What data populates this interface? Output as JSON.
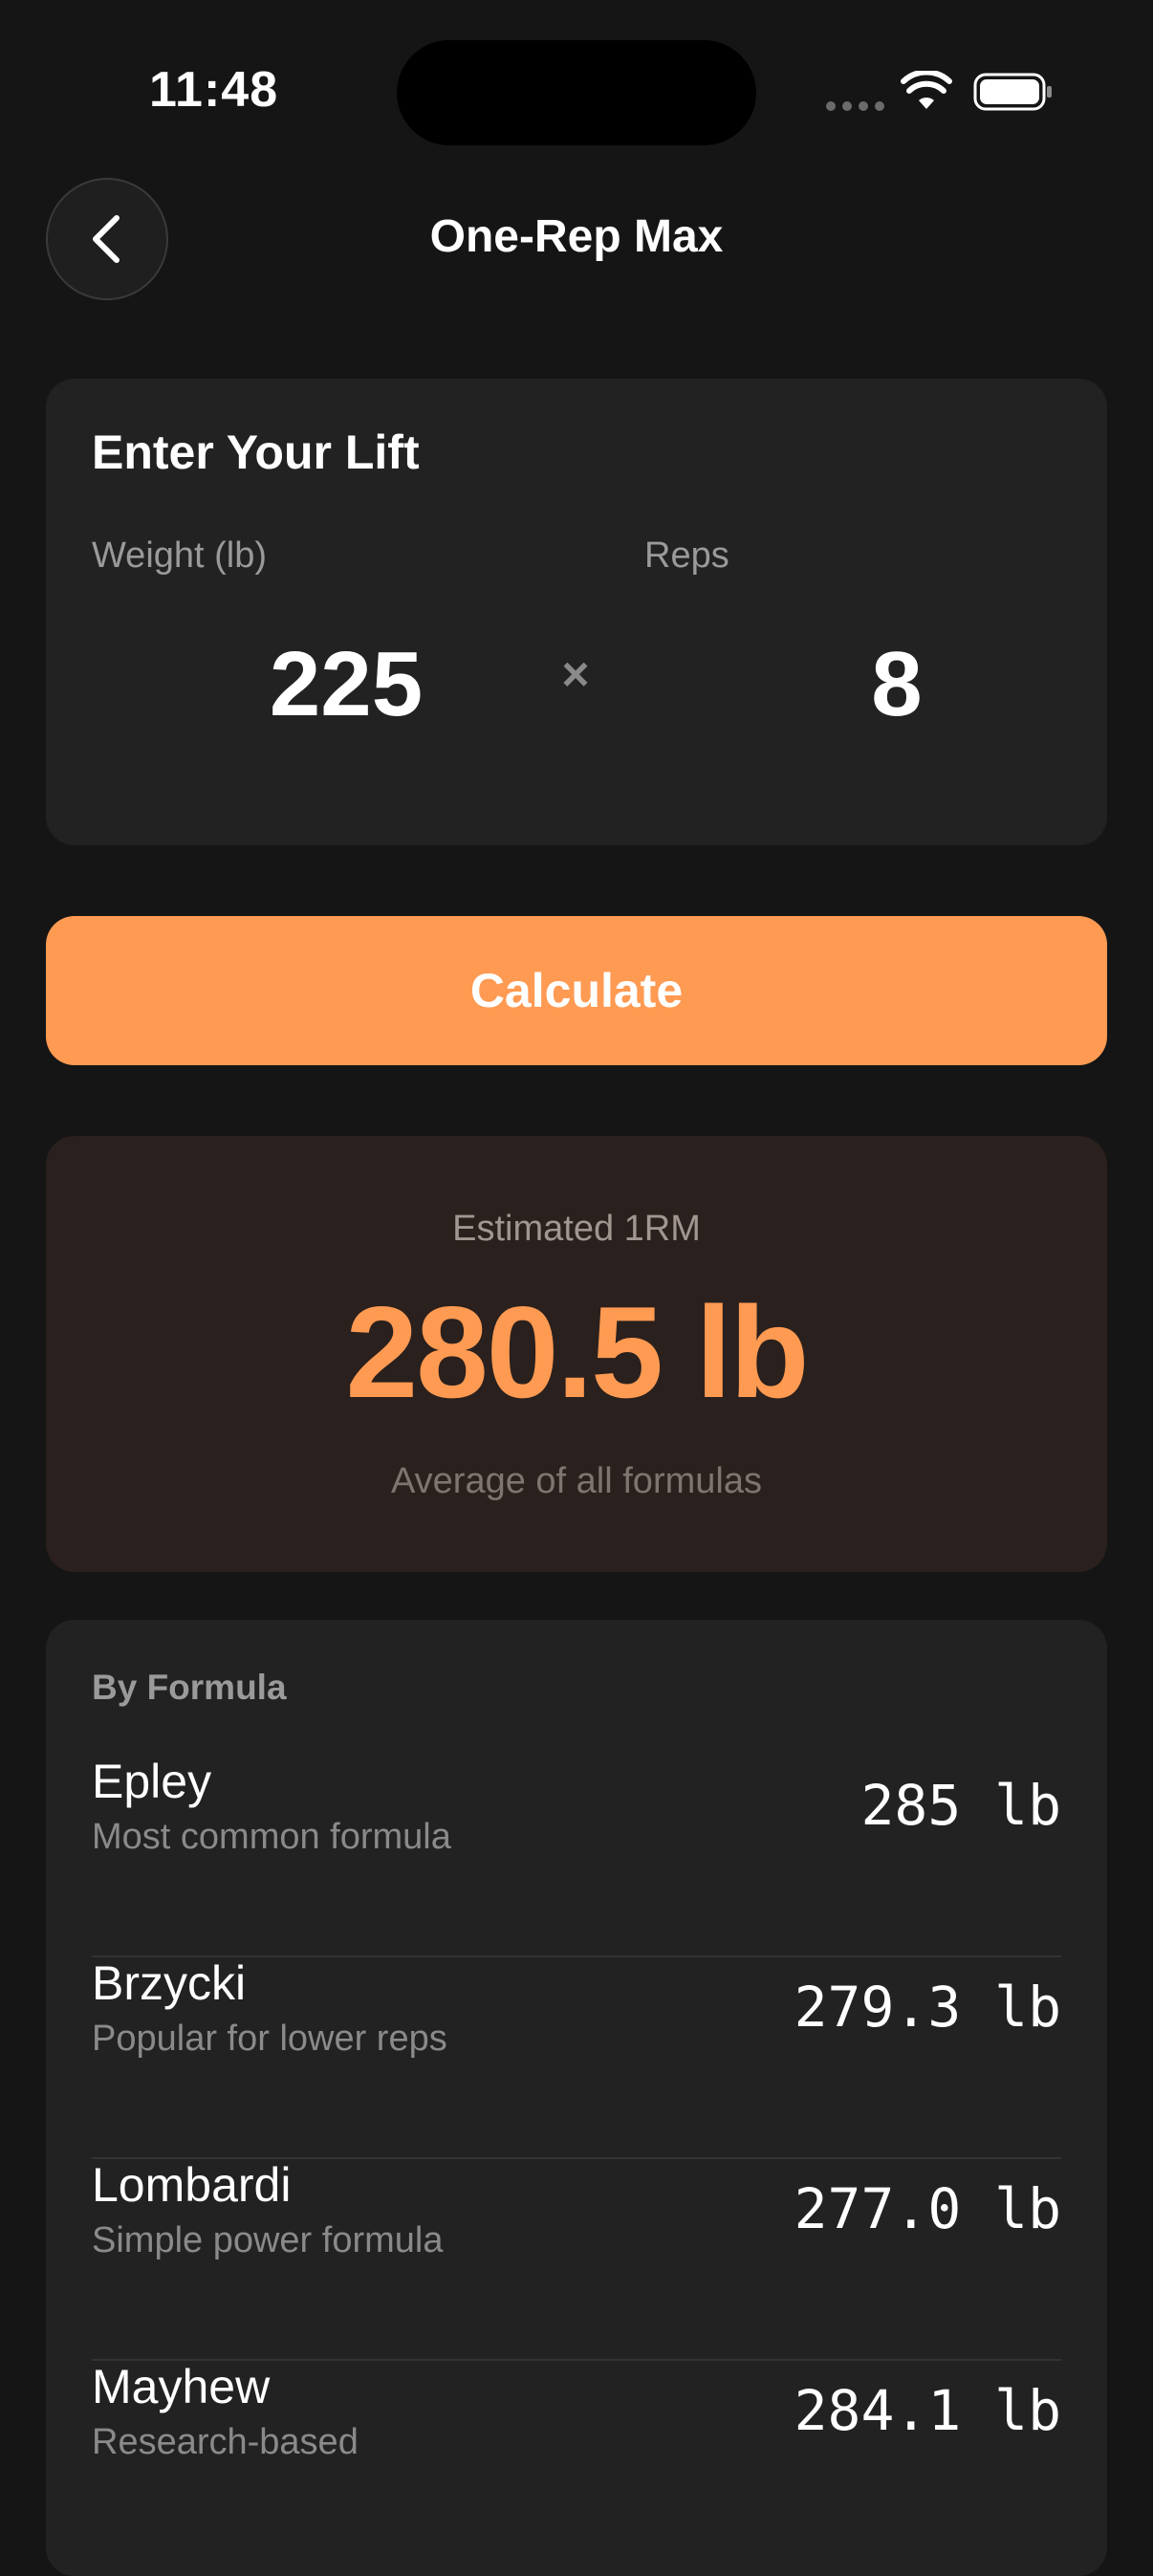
{
  "status_bar": {
    "time": "11:48"
  },
  "header": {
    "title": "One-Rep Max",
    "back_icon": "chevron-left-icon"
  },
  "input_card": {
    "heading": "Enter Your Lift",
    "weight_label": "Weight (lb)",
    "weight_value": "225",
    "reps_label": "Reps",
    "reps_value": "8",
    "times_sign": "×"
  },
  "calculate_button": {
    "label": "Calculate",
    "color": "#ff9a52"
  },
  "result": {
    "label": "Estimated 1RM",
    "value": "280.5 lb",
    "note": "Average of all formulas",
    "accent_color": "#ff9a52"
  },
  "formulas": {
    "heading": "By Formula",
    "items": [
      {
        "name": "Epley",
        "description": "Most common formula",
        "value": "285 lb"
      },
      {
        "name": "Brzycki",
        "description": "Popular for lower reps",
        "value": "279.3 lb"
      },
      {
        "name": "Lombardi",
        "description": "Simple power formula",
        "value": "277.0 lb"
      },
      {
        "name": "Mayhew",
        "description": "Research-based",
        "value": "284.1 lb"
      }
    ]
  }
}
